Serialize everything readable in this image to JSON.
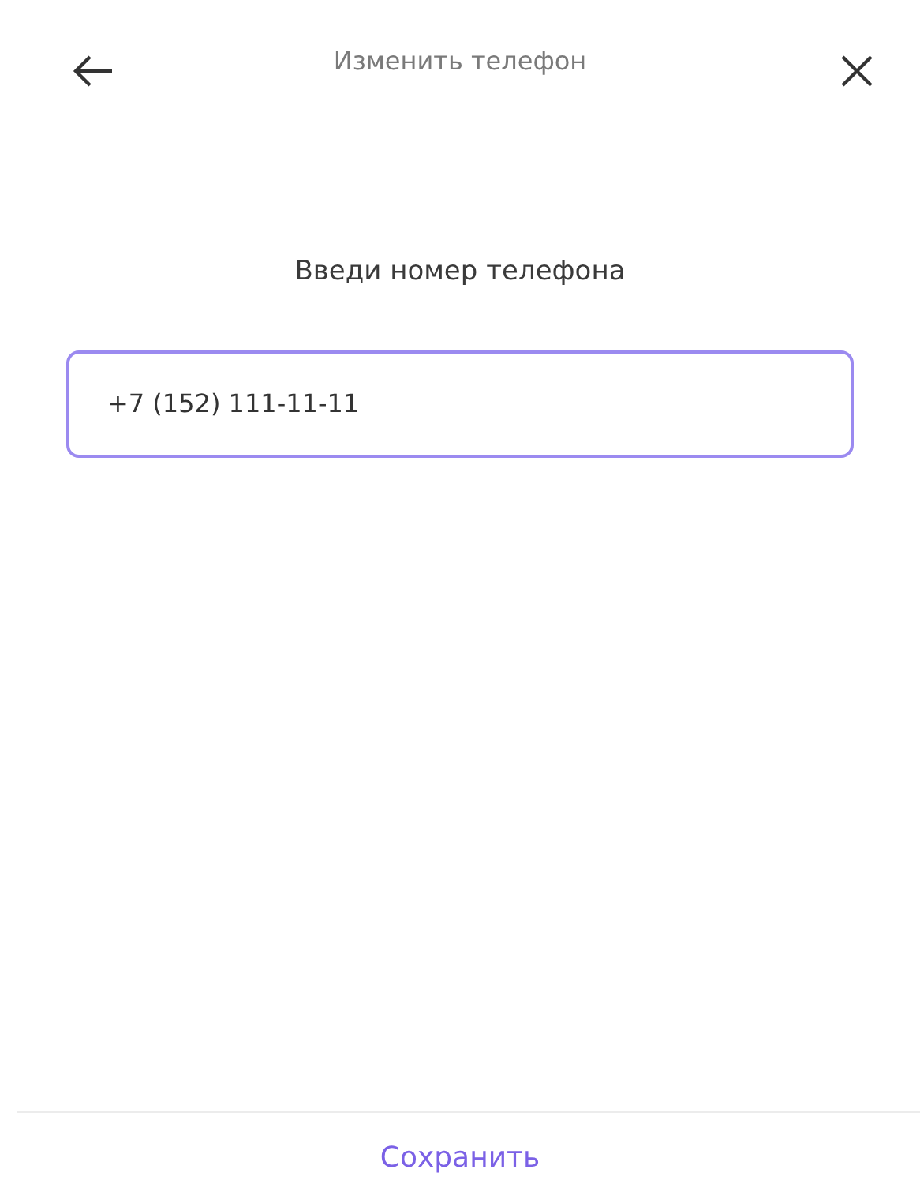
{
  "header": {
    "title": "Изменить телефон"
  },
  "prompt": "Введи номер телефона",
  "phone_field": {
    "value": "+7 (152) 111-11-11",
    "focused": true
  },
  "save_button": {
    "label": "Сохранить"
  }
}
